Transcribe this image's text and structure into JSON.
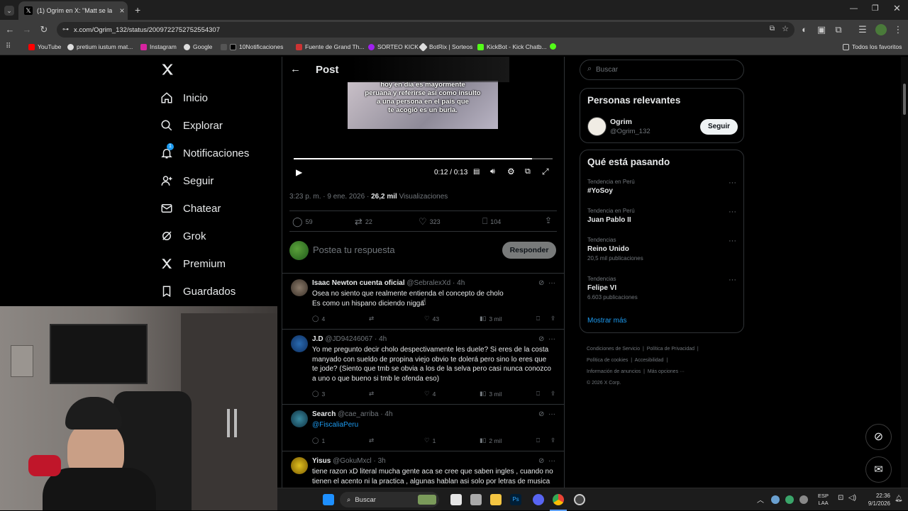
{
  "browser": {
    "tab_title": "(1) Ogrim en X: \"Matt se lanza l",
    "url": "x.com/Ogrim_132/status/2009722752752554307",
    "bookmarks": [
      "YouTube",
      "pretium iustum mat...",
      "Instagram",
      "Google",
      "10Notificaciones",
      "Fuente de Grand Th...",
      "SORTEO KICK",
      "BotRix | Sorteos",
      "KickBot - Kick Chatb...",
      "Todos los favoritos"
    ]
  },
  "sidebar": {
    "items": [
      {
        "label": "Inicio",
        "icon": "home-icon"
      },
      {
        "label": "Explorar",
        "icon": "search-icon"
      },
      {
        "label": "Notificaciones",
        "icon": "bell-icon",
        "badge": "1"
      },
      {
        "label": "Seguir",
        "icon": "follow-icon"
      },
      {
        "label": "Chatear",
        "icon": "mail-icon"
      },
      {
        "label": "Grok",
        "icon": "grok-icon"
      },
      {
        "label": "Premium",
        "icon": "x-icon"
      },
      {
        "label": "Guardados",
        "icon": "bookmark-icon"
      }
    ]
  },
  "post": {
    "header": "Post",
    "video_caption": [
      "hoy en día es mayormente",
      "peruana y referirse así como insulto",
      "a una persona en el país que",
      "te acogió es un burla."
    ],
    "video_time": "0:12 / 0:13",
    "video_progress": 0.92,
    "meta_time": "3:23 p. m. · 9 ene. 2026 · ",
    "views_count": "26,2 mil",
    "views_label": "Visualizaciones",
    "replies": "59",
    "reposts": "22",
    "likes": "323",
    "bookmarks": "104",
    "reply_placeholder": "Postea tu respuesta",
    "reply_button": "Responder"
  },
  "replies": [
    {
      "name": "Isaac Newton cuenta oficial",
      "handle": "@SebralexXd · 4h",
      "lines": [
        "Osea no siento que realmente entienda el concepto de cholo",
        "Es como un hispano diciendo nigga"
      ],
      "replies": "4",
      "reposts": "",
      "likes": "43",
      "views": "3 mil"
    },
    {
      "name": "J.D",
      "handle": "@JD94246067 · 4h",
      "lines": [
        "Yo me pregunto decir cholo despectivamente les duele? Si eres de la costa",
        "manyado con sueldo de propina viejo obvio te dolerá pero sino lo eres que",
        "te jode? (Siento que tmb se obvia a los de la selva pero casi nunca conozco",
        "a uno o que bueno si tmb le ofenda eso)"
      ],
      "replies": "3",
      "reposts": "",
      "likes": "4",
      "views": "3 mil"
    },
    {
      "name": "Search",
      "handle": "@cae_arriba · 4h",
      "lines": [
        "@FiscaliaPeru"
      ],
      "replies": "1",
      "reposts": "",
      "likes": "1",
      "views": "2 mil"
    },
    {
      "name": "Yisus",
      "handle": "@GokuMxcl · 3h",
      "lines": [
        "tiene razon xD literal mucha gente aca se cree que saben ingles , cuando no",
        "tienen el acento ni la practica , algunas hablan asi solo por letras de musica"
      ]
    }
  ],
  "right": {
    "search_placeholder": "Buscar",
    "relevant_title": "Personas relevantes",
    "person_name": "Ogrim",
    "person_handle": "@Ogrim_132",
    "follow_button": "Seguir",
    "trends_title": "Qué está pasando",
    "trends": [
      {
        "category": "Tendencia en Perú",
        "name": "#YoSoy",
        "count": ""
      },
      {
        "category": "Tendencia en Perú",
        "name": "Juan Pablo II",
        "count": ""
      },
      {
        "category": "Tendencias",
        "name": "Reino Unido",
        "count": "20,5 mil publicaciones"
      },
      {
        "category": "Tendencias",
        "name": "Felipe VI",
        "count": "6.603 publicaciones"
      }
    ],
    "show_more": "Mostrar más",
    "footer": [
      "Condiciones de Servicio",
      "Política de Privacidad",
      "Política de cookies",
      "Accesibilidad",
      "Información de anuncios",
      "Más opciones ···",
      "© 2026 X Corp."
    ]
  },
  "taskbar": {
    "search": "Buscar",
    "lang": "ESP",
    "lang2": "LAA",
    "time": "22:36",
    "date": "9/1/2026"
  },
  "colors": {
    "accent": "#1d9bf0",
    "bg": "#000000",
    "border": "#2f3336",
    "muted": "#71767b"
  }
}
